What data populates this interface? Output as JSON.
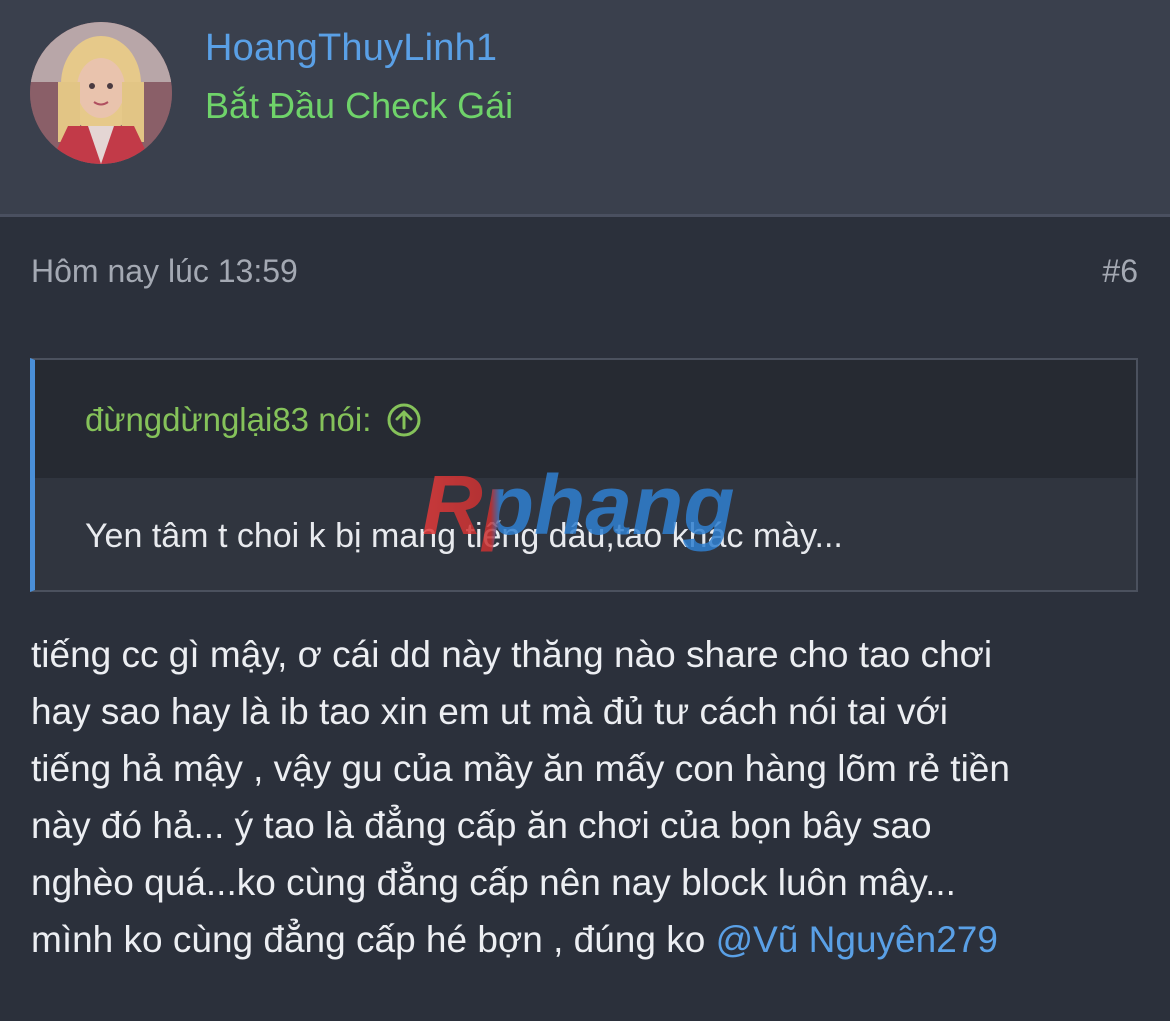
{
  "user": {
    "name": "HoangThuyLinh1",
    "title": "Bắt Đầu Check Gái"
  },
  "post": {
    "timestamp": "Hôm nay lúc 13:59",
    "number": "#6",
    "quote": {
      "author": "đừngdừnglại83 nói:",
      "text": "Yen tâm t choi k bị mang tiếng dâu,tao khác mày..."
    },
    "body_lines": [
      "tiếng cc gì mậy, ơ cái dd này thăng nào share cho tao chơi",
      "hay sao hay là ib tao xin em ut mà đủ tư cách nói tai với",
      "tiếng hả mậy , vậy gu của mầy ăn mấy con hàng lõm rẻ tiền",
      "này đó hả... ý tao là đẳng cấp ăn chơi của bọn bây sao",
      "nghèo quá...ko cùng đẳng cấp nên nay block luôn mây..."
    ],
    "last_line_text": "mình ko cùng đẳng cấp hé bợn , đúng ko ",
    "mention": "@Vũ Nguyên279"
  },
  "watermark": {
    "text": "Rphang"
  },
  "colors": {
    "background": "#2b303b",
    "username": "#5aa0e6",
    "user_title": "#6fd36a",
    "quote_author": "#85c25a",
    "quote_border": "#4a8fd8",
    "mention": "#5aa0e6"
  },
  "icons": {
    "quote_jump": "arrow-up-circle-icon"
  }
}
